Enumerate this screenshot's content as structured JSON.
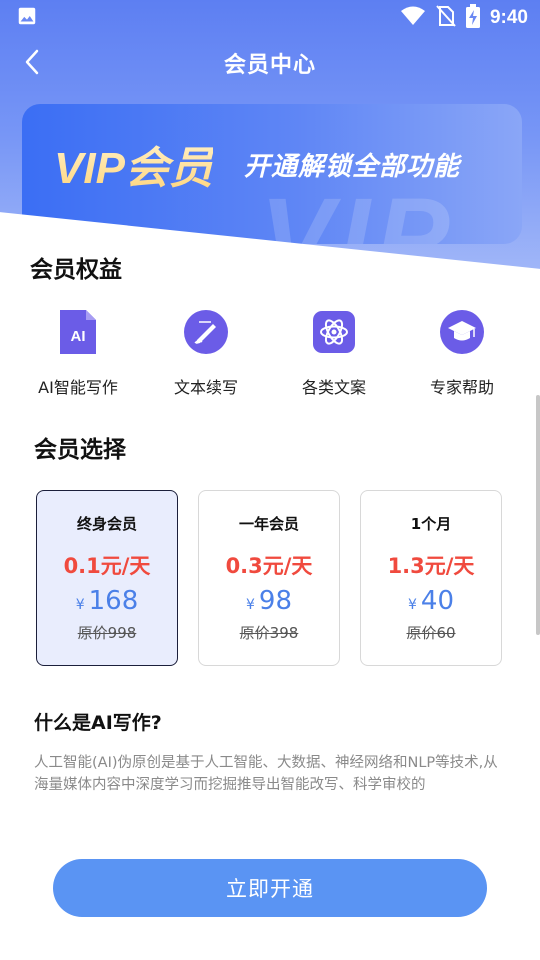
{
  "status_bar": {
    "time": "9:40",
    "icons": [
      "image-icon",
      "wifi-icon",
      "no-sim-icon",
      "battery-charging-icon"
    ]
  },
  "header": {
    "title": "会员中心",
    "back_icon": "chevron-left-icon"
  },
  "banner": {
    "title": "VIP会员",
    "subtitle": "开通解锁全部功能",
    "watermark": "VIP"
  },
  "benefits": {
    "title": "会员权益",
    "items": [
      {
        "label": "AI智能写作",
        "icon": "ai-document-icon",
        "badge": "AI"
      },
      {
        "label": "文本续写",
        "icon": "pen-icon"
      },
      {
        "label": "各类文案",
        "icon": "atom-icon"
      },
      {
        "label": "专家帮助",
        "icon": "graduation-cap-icon"
      }
    ]
  },
  "plans": {
    "title": "会员选择",
    "items": [
      {
        "name": "终身会员",
        "daily": "0.1元/天",
        "currency": "¥",
        "price": "168",
        "original": "原价998",
        "selected": true
      },
      {
        "name": "一年会员",
        "daily": "0.3元/天",
        "currency": "¥",
        "price": "98",
        "original": "原价398",
        "selected": false
      },
      {
        "name": "1个月",
        "daily": "1.3元/天",
        "currency": "¥",
        "price": "40",
        "original": "原价60",
        "selected": false
      }
    ]
  },
  "faq": {
    "title": "什么是AI写作?",
    "text": "人工智能(AI)伪原创是基于人工智能、大数据、神经网络和NLP等技术,从海量媒体内容中深度学习而挖掘推导出智能改写、科学审校的"
  },
  "cta": {
    "label": "立即开通"
  },
  "colors": {
    "accent": "#5a94f3",
    "price_red": "#f04a3e",
    "price_blue": "#4b80e8",
    "icon_purple": "#6b5ce7"
  }
}
